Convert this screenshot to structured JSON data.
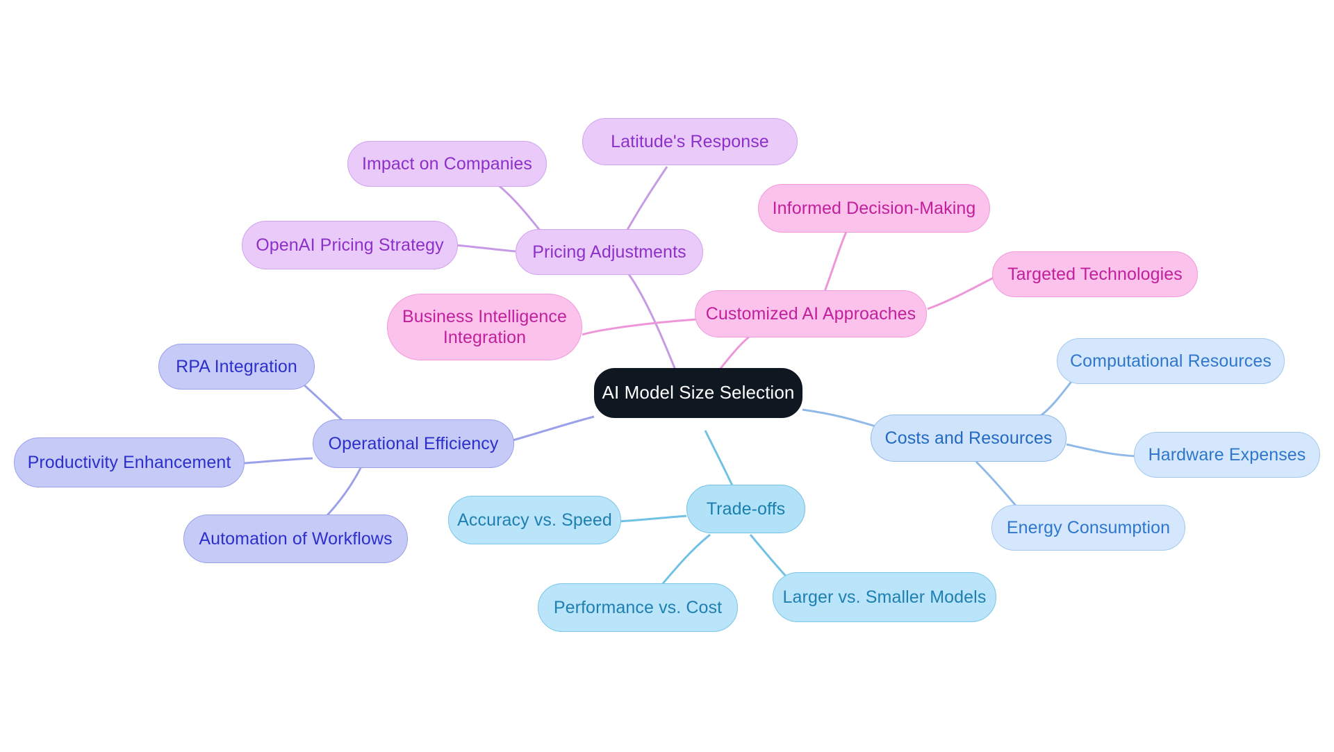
{
  "diagram": {
    "type": "mindmap",
    "title": "AI Model Size Selection",
    "background_color": "#ffffff",
    "root": {
      "label": "AI Model Size Selection",
      "fill": "#0f1720",
      "text_color": "#ffffff"
    },
    "branches": [
      {
        "label": "Costs and Resources",
        "fill": "#cfe4fb",
        "text_color": "#2268c4",
        "edge_color": "#8fb9e8",
        "children": [
          {
            "label": "Computational Resources"
          },
          {
            "label": "Hardware Expenses"
          },
          {
            "label": "Energy Consumption"
          }
        ]
      },
      {
        "label": "Trade-offs",
        "fill": "#b1e2f8",
        "text_color": "#1a7fae",
        "edge_color": "#71c1e6",
        "children": [
          {
            "label": "Accuracy vs. Speed"
          },
          {
            "label": "Performance vs. Cost"
          },
          {
            "label": "Larger vs. Smaller Models"
          }
        ]
      },
      {
        "label": "Operational Efficiency",
        "fill": "#c6caf6",
        "text_color": "#2d2fcb",
        "edge_color": "#9aa0ea",
        "children": [
          {
            "label": "RPA Integration"
          },
          {
            "label": "Productivity Enhancement"
          },
          {
            "label": "Automation of Workflows"
          }
        ]
      },
      {
        "label": "Pricing Adjustments",
        "fill": "#e9caf8",
        "text_color": "#8c30c9",
        "edge_color": "#c79ae6",
        "children": [
          {
            "label": "Impact on Companies"
          },
          {
            "label": "Latitude's Response"
          },
          {
            "label": "OpenAI Pricing Strategy"
          }
        ]
      },
      {
        "label": "Customized AI Approaches",
        "fill": "#fbc2ec",
        "text_color": "#c2209b",
        "edge_color": "#ef96d8",
        "children": [
          {
            "label": "Informed Decision-Making"
          },
          {
            "label": "Targeted Technologies"
          },
          {
            "label": "Business Intelligence\nIntegration"
          }
        ]
      }
    ]
  },
  "nodes": {
    "root": "AI Model Size Selection",
    "costs_and_resources": "Costs and Resources",
    "computational_resources": "Computational Resources",
    "hardware_expenses": "Hardware Expenses",
    "energy_consumption": "Energy Consumption",
    "trade_offs": "Trade-offs",
    "accuracy_vs_speed": "Accuracy vs. Speed",
    "performance_vs_cost": "Performance vs. Cost",
    "larger_vs_smaller_models": "Larger vs. Smaller Models",
    "operational_efficiency": "Operational Efficiency",
    "rpa_integration": "RPA Integration",
    "productivity_enhancement": "Productivity Enhancement",
    "automation_of_workflows": "Automation of Workflows",
    "pricing_adjustments": "Pricing Adjustments",
    "impact_on_companies": "Impact on Companies",
    "latitudes_response": "Latitude's Response",
    "openai_pricing_strategy": "OpenAI Pricing Strategy",
    "customized_ai_approaches": "Customized AI Approaches",
    "informed_decision_making": "Informed Decision-Making",
    "targeted_technologies": "Targeted Technologies",
    "business_intelligence_integration": "Business Intelligence\nIntegration"
  }
}
